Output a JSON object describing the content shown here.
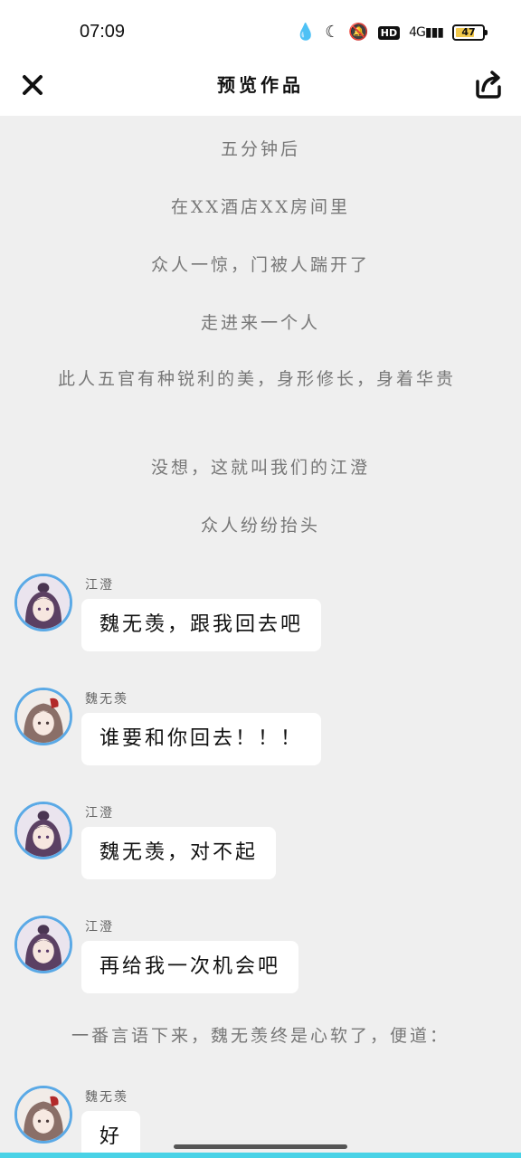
{
  "status": {
    "time": "07:09",
    "icons": [
      "water-drop-icon",
      "moon-icon",
      "bell-off-icon",
      "hd-icon",
      "signal-icon"
    ],
    "hd_label": "HD",
    "network_label": "4G",
    "battery": "47"
  },
  "header": {
    "title": "预览作品",
    "close_icon": "close-icon",
    "share_icon": "share-icon"
  },
  "narration": [
    "五分钟后",
    "在XX酒店XX房间里",
    "众人一惊，门被人踹开了",
    "走进来一个人",
    "此人五官有种锐利的美，身形修长，身着华贵",
    "没想，这就叫我们的江澄",
    "众人纷纷抬头",
    "一番言语下来，魏无羡终是心软了，便道："
  ],
  "messages": [
    {
      "name": "江澄",
      "text": "魏无羡，跟我回去吧"
    },
    {
      "name": "魏无羡",
      "text": "谁要和你回去！！！"
    },
    {
      "name": "江澄",
      "text": "魏无羡，对不起"
    },
    {
      "name": "江澄",
      "text": "再给我一次机会吧"
    },
    {
      "name": "魏无羡",
      "text": "好"
    }
  ],
  "colors": {
    "avatar_border": "#5aa9e6",
    "bottom_accent": "#49d2e6"
  }
}
